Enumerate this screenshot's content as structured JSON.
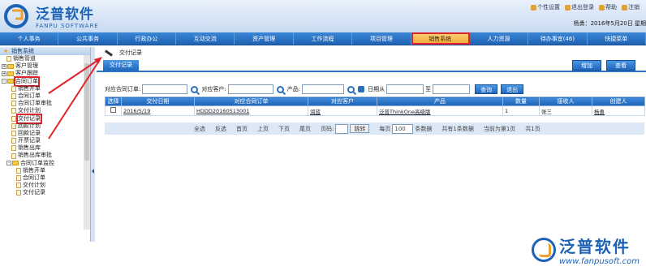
{
  "header": {
    "logo_cn": "泛普软件",
    "logo_en": "FANPU SOFTWARE",
    "links": [
      "个性设置",
      "退出登录",
      "帮助",
      "注销"
    ],
    "user_line": "杨勇：2016年5月20日 星期"
  },
  "nav": [
    "个人事务",
    "公共事务",
    "行政办公",
    "互动交流",
    "资产管理",
    "工作流程",
    "项目管理",
    "销售系统",
    "人力资源",
    "待办事宜(46)",
    "快捷菜单"
  ],
  "sidebar": {
    "title": "销售系统",
    "items": [
      {
        "label": "销售管道",
        "indent": 1,
        "type": "doc"
      },
      {
        "label": "客户管理",
        "indent": 0,
        "type": "folder",
        "toggle": "+"
      },
      {
        "label": "客户跟踪",
        "indent": 0,
        "type": "folder",
        "toggle": "+"
      },
      {
        "label": "合同订单",
        "indent": 0,
        "type": "folder",
        "toggle": "-",
        "highlight": true
      },
      {
        "label": "销售开单",
        "indent": 2,
        "type": "doc"
      },
      {
        "label": "合同订单",
        "indent": 2,
        "type": "doc"
      },
      {
        "label": "合同订单审批",
        "indent": 2,
        "type": "doc"
      },
      {
        "label": "交付计划",
        "indent": 2,
        "type": "doc"
      },
      {
        "label": "交付记录",
        "indent": 2,
        "type": "doc",
        "highlight": true
      },
      {
        "label": "回款计划",
        "indent": 2,
        "type": "doc"
      },
      {
        "label": "回款记录",
        "indent": 2,
        "type": "doc"
      },
      {
        "label": "开票记录",
        "indent": 2,
        "type": "doc"
      },
      {
        "label": "销售出库",
        "indent": 2,
        "type": "doc"
      },
      {
        "label": "销售出库审批",
        "indent": 2,
        "type": "doc"
      },
      {
        "label": "合同订单监控",
        "indent": 1,
        "type": "folder",
        "toggle": "-"
      },
      {
        "label": "销售开单",
        "indent": 3,
        "type": "doc"
      },
      {
        "label": "合同订单",
        "indent": 3,
        "type": "doc"
      },
      {
        "label": "交付计划",
        "indent": 3,
        "type": "doc"
      },
      {
        "label": "交付记录",
        "indent": 3,
        "type": "doc"
      }
    ]
  },
  "main": {
    "breadcrumb": "交付记录",
    "tab": "交付记录",
    "add_label": "增加",
    "view_label": "查看",
    "filters": {
      "order_label": "对应合同订单:",
      "customer_label": "对应客户:",
      "product_label": "产品:",
      "date_label": "日期从",
      "to_label": "至",
      "search_label": "查询",
      "exit_label": "退出"
    },
    "table": {
      "headers": [
        "选择",
        "交付日期",
        "对应合同订单",
        "对应客户",
        "产品",
        "数量",
        "接收人",
        "创建人"
      ],
      "rows": [
        {
          "date": "2016/5/19",
          "order": "HDDD20160513001",
          "customer": "润蓝",
          "product": "泛普ThinkOne高级版",
          "qty": "1",
          "receiver": "张三",
          "creator": "杨勇"
        }
      ]
    },
    "pager": {
      "select_all": "全选",
      "invert": "反选",
      "first": "首页",
      "prev": "上页",
      "next": "下页",
      "last": "尾页",
      "page_code": "页码:",
      "goto": "跳转",
      "per_page_prefix": "每页",
      "per_page": "100",
      "per_page_suffix": "条数据",
      "total": "共有1条数据",
      "current": "当前为第1页",
      "pages": "共1页"
    }
  },
  "footer": {
    "cn": "泛普软件",
    "url": "www.fanpusoft.com"
  },
  "colors": {
    "accent": "#1f68bd",
    "highlight": "#e0242b",
    "active_tab": "#f1a436"
  }
}
